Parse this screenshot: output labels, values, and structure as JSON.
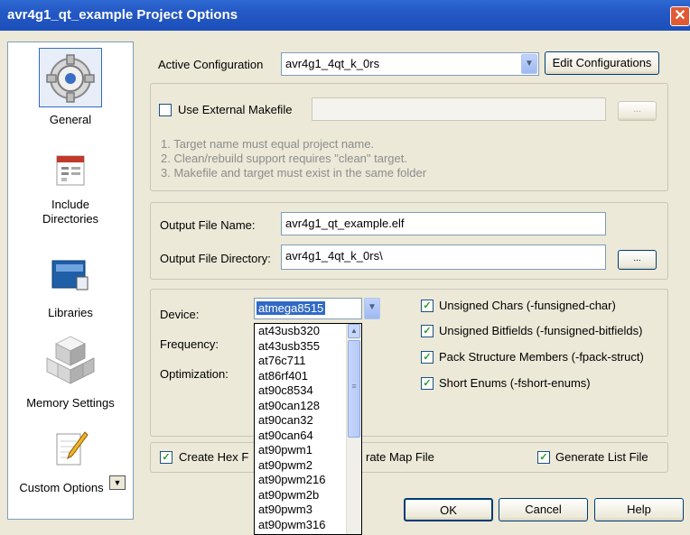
{
  "window": {
    "title": "avr4g1_qt_example Project Options",
    "close_glyph": "✕"
  },
  "sidebar": {
    "items": [
      {
        "label": "General",
        "icon": "gear-icon"
      },
      {
        "label": "Include\nDirectories",
        "icon": "folder-list-icon"
      },
      {
        "label": "Libraries",
        "icon": "book-icon"
      },
      {
        "label": "Memory Settings",
        "icon": "cubes-icon"
      },
      {
        "label": "Custom Options",
        "icon": "notepad-pencil-icon"
      }
    ]
  },
  "config": {
    "label": "Active Configuration",
    "value": "avr4g1_4qt_k_0rs",
    "edit_button": "Edit Configurations"
  },
  "makefile": {
    "checkbox_label": "Use External Makefile",
    "checked": false,
    "value": "",
    "browse_label": "...",
    "notes": [
      "1. Target name must equal project name.",
      "2. Clean/rebuild support requires  \"clean\" target.",
      "3. Makefile and target must exist in the same folder"
    ]
  },
  "output": {
    "file_name_label": "Output File Name:",
    "file_name_value": "avr4g1_qt_example.elf",
    "dir_label": "Output File Directory:",
    "dir_value": "avr4g1_4qt_k_0rs\\",
    "browse_label": "..."
  },
  "device": {
    "device_label": "Device:",
    "device_value": "atmega8515",
    "frequency_label": "Frequency:",
    "optimization_label": "Optimization:",
    "options": [
      "at43usb320",
      "at43usb355",
      "at76c711",
      "at86rf401",
      "at90c8534",
      "at90can128",
      "at90can32",
      "at90can64",
      "at90pwm1",
      "at90pwm2",
      "at90pwm216",
      "at90pwm2b",
      "at90pwm3",
      "at90pwm316"
    ]
  },
  "flags": [
    {
      "label": "Unsigned Chars (-funsigned-char)",
      "checked": true
    },
    {
      "label": "Unsigned Bitfields (-funsigned-bitfields)",
      "checked": true
    },
    {
      "label": "Pack Structure Members (-fpack-struct)",
      "checked": true
    },
    {
      "label": "Short Enums (-fshort-enums)",
      "checked": true
    }
  ],
  "generate": {
    "hex_label": "Create Hex F",
    "map_label": "rate Map File",
    "list_label": "Generate List File",
    "check_glyph": "✓"
  },
  "buttons": {
    "ok": "OK",
    "cancel": "Cancel",
    "help": "Help"
  }
}
